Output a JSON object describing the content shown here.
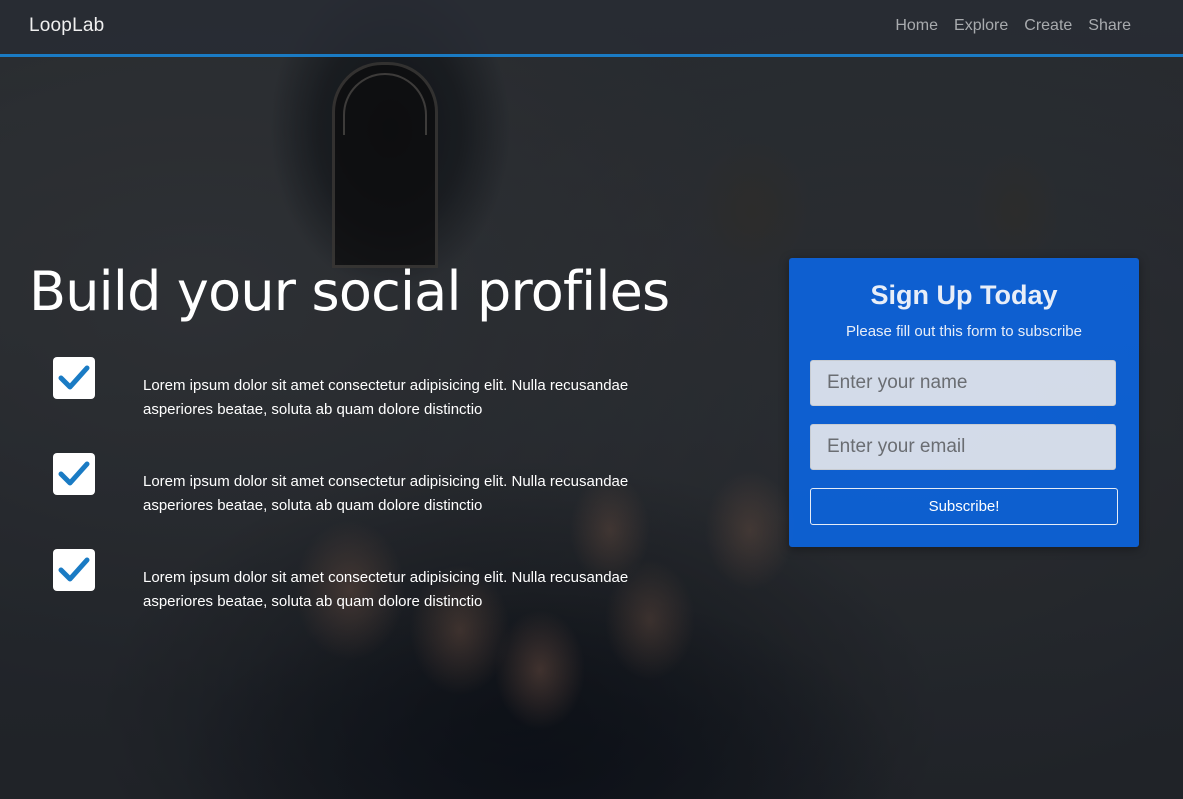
{
  "navbar": {
    "brand": "LoopLab",
    "links": [
      "Home",
      "Explore",
      "Create",
      "Share"
    ],
    "accent_color": "#1a7bc4"
  },
  "hero": {
    "title": "Build your social profiles",
    "features": [
      {
        "icon": "check-icon",
        "text": "Lorem ipsum dolor sit amet consectetur adipisicing elit. Nulla recusandae asperiores beatae, soluta ab quam dolore distinctio"
      },
      {
        "icon": "check-icon",
        "text": "Lorem ipsum dolor sit amet consectetur adipisicing elit. Nulla recusandae asperiores beatae, soluta ab quam dolore distinctio"
      },
      {
        "icon": "check-icon",
        "text": "Lorem ipsum dolor sit amet consectetur adipisicing elit. Nulla recusandae asperiores beatae, soluta ab quam dolore distinctio"
      }
    ],
    "check_color": "#1a7bc4"
  },
  "signup": {
    "title": "Sign Up Today",
    "subtitle": "Please fill out this form to subscribe",
    "name_placeholder": "Enter your name",
    "email_placeholder": "Enter your email",
    "button_label": "Subscribe!",
    "card_color": "#0a66e6"
  }
}
